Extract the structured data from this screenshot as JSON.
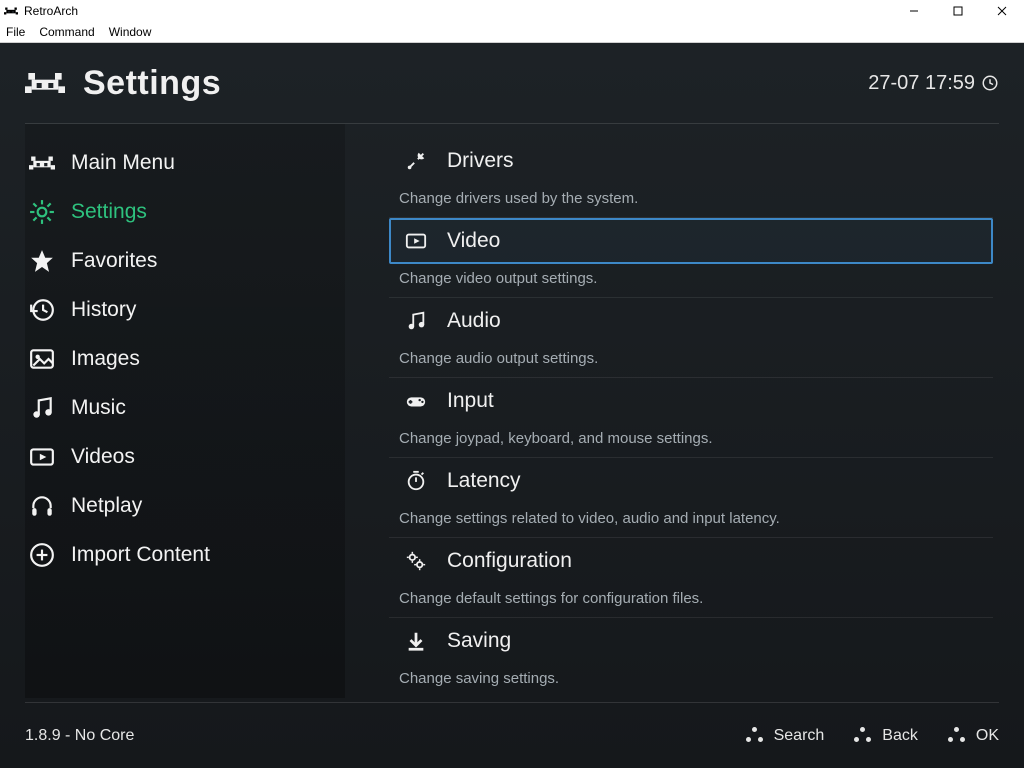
{
  "window": {
    "title": "RetroArch",
    "menus": [
      "File",
      "Command",
      "Window"
    ]
  },
  "header": {
    "title": "Settings",
    "clock": "27-07 17:59"
  },
  "sidebar": {
    "items": [
      {
        "label": "Main Menu",
        "icon": "invader"
      },
      {
        "label": "Settings",
        "icon": "gear",
        "active": true
      },
      {
        "label": "Favorites",
        "icon": "star"
      },
      {
        "label": "History",
        "icon": "history"
      },
      {
        "label": "Images",
        "icon": "image"
      },
      {
        "label": "Music",
        "icon": "music"
      },
      {
        "label": "Videos",
        "icon": "video"
      },
      {
        "label": "Netplay",
        "icon": "headset"
      },
      {
        "label": "Import Content",
        "icon": "plus"
      }
    ]
  },
  "settings": [
    {
      "label": "Drivers",
      "icon": "tools",
      "desc": "Change drivers used by the system."
    },
    {
      "label": "Video",
      "icon": "video",
      "desc": "Change video output settings.",
      "selected": true
    },
    {
      "label": "Audio",
      "icon": "music",
      "desc": "Change audio output settings."
    },
    {
      "label": "Input",
      "icon": "gamepad",
      "desc": "Change joypad, keyboard, and mouse settings."
    },
    {
      "label": "Latency",
      "icon": "timer",
      "desc": "Change settings related to video, audio and input latency."
    },
    {
      "label": "Configuration",
      "icon": "gears",
      "desc": "Change default settings for configuration files."
    },
    {
      "label": "Saving",
      "icon": "download",
      "desc": "Change saving settings."
    }
  ],
  "footer": {
    "version": "1.8.9 - No Core",
    "actions": [
      {
        "label": "Search"
      },
      {
        "label": "Back"
      },
      {
        "label": "OK"
      }
    ]
  }
}
